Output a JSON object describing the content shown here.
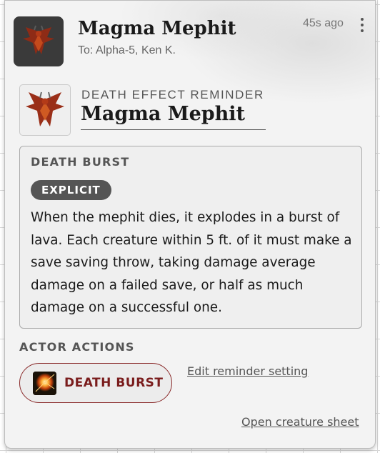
{
  "header": {
    "title": "Magma Mephit",
    "recipients": "To: Alpha-5, Ken K.",
    "timestamp": "45s ago",
    "avatar_icon": "mephit-portrait-icon",
    "menu_icon": "vertical-ellipsis-icon"
  },
  "reminder": {
    "kicker": "DEATH EFFECT REMINDER",
    "creature_name": "Magma Mephit",
    "portrait_icon": "mephit-portrait-icon"
  },
  "effect": {
    "title": "DEATH BURST",
    "badge": "EXPLICIT",
    "description": "When the mephit dies, it explodes in a burst of lava. Each creature within 5 ft. of it must make a save saving throw, taking damage average damage on a failed save, or half as much damage on a successful one."
  },
  "actions": {
    "title": "ACTOR ACTIONS",
    "button_label": "DEATH BURST",
    "button_icon": "burst-icon",
    "edit_link": "Edit reminder setting",
    "sheet_link": "Open creature sheet"
  },
  "colors": {
    "accent": "#7a1d1d",
    "badge": "#555555"
  }
}
